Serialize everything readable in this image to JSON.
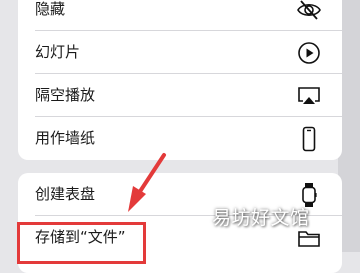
{
  "menu": {
    "hide": "隐藏",
    "slideshow": "幻灯片",
    "airplay": "隔空播放",
    "wallpaper": "用作墙纸",
    "watch_face": "创建表盘",
    "save_to_files": "存储到“文件”"
  },
  "icons": {
    "hide": "eye-slash-icon",
    "slideshow": "play-circle-icon",
    "airplay": "airplay-icon",
    "wallpaper": "iphone-icon",
    "watch_face": "watch-icon",
    "save_to_files": "folder-icon"
  },
  "annotation": {
    "arrow_color": "#e33a3a",
    "box_color": "#e33a3a"
  },
  "watermark": "易坊好文馆"
}
